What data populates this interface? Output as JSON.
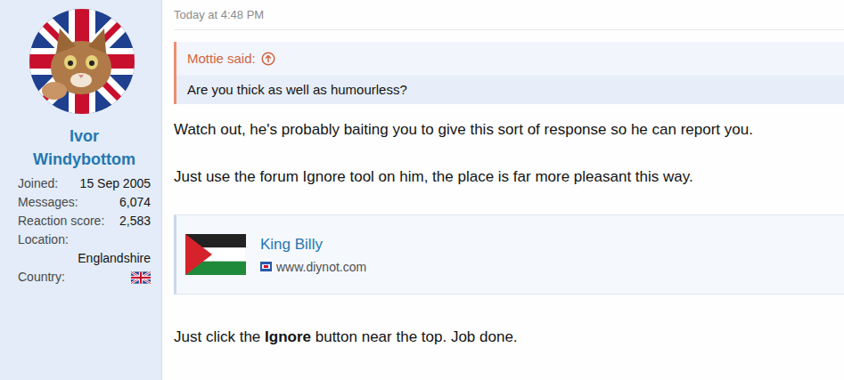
{
  "post": {
    "time": "Today at 4:48 PM"
  },
  "user": {
    "name": "Ivor Windybottom",
    "stats": [
      {
        "label": "Joined:",
        "value": "15 Sep 2005",
        "kind": "inline"
      },
      {
        "label": "Messages:",
        "value": "6,074",
        "kind": "inline"
      },
      {
        "label": "Reaction score:",
        "value": "2,583",
        "kind": "inline"
      },
      {
        "label": "Location:",
        "value": "Englandshire",
        "kind": "stacked"
      },
      {
        "label": "Country:",
        "value": "",
        "kind": "flag"
      }
    ]
  },
  "quote": {
    "author": "Mottie said:",
    "text": "Are you thick as well as humourless?"
  },
  "paragraphs": [
    [
      {
        "text": "Watch out, he's probably baiting you to give this sort of response so he can report you.",
        "bold": false
      }
    ],
    [
      {
        "text": "Just use the forum Ignore tool on him, the place is far more pleasant this way.",
        "bold": false
      }
    ]
  ],
  "embed": {
    "title": "King Billy",
    "site": "www.diynot.com"
  },
  "closing": [
    {
      "text": "Just click the ",
      "bold": false
    },
    {
      "text": "Ignore",
      "bold": true
    },
    {
      "text": " button near the top. Job done.",
      "bold": false
    }
  ]
}
